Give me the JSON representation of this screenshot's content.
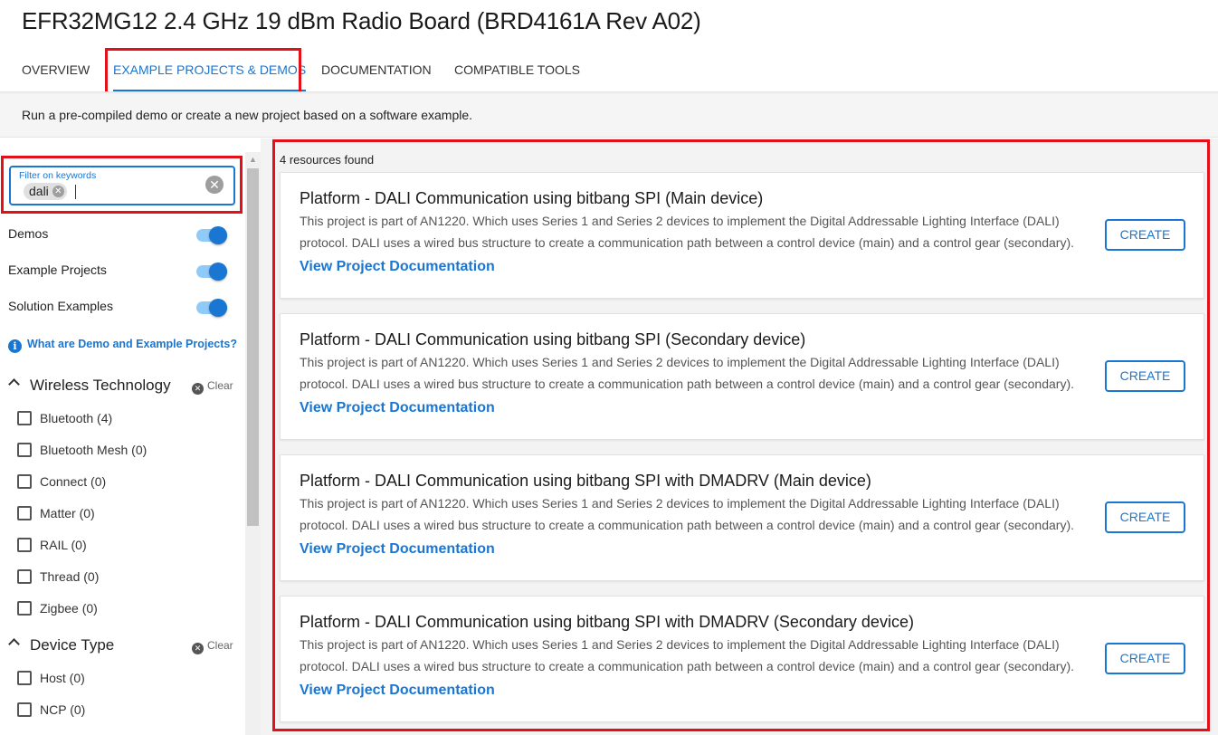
{
  "page": {
    "title": "EFR32MG12 2.4 GHz 19 dBm Radio Board (BRD4161A Rev A02)",
    "subtitle": "Run a pre-compiled demo or create a new project based on a software example."
  },
  "tabs": [
    {
      "label": "OVERVIEW",
      "active": false
    },
    {
      "label": "EXAMPLE PROJECTS & DEMOS",
      "active": true
    },
    {
      "label": "DOCUMENTATION",
      "active": false
    },
    {
      "label": "COMPATIBLE TOOLS",
      "active": false
    }
  ],
  "filter": {
    "label": "Filter on keywords",
    "chips": [
      "dali"
    ],
    "value": ""
  },
  "toggles": [
    {
      "label": "Demos",
      "on": true
    },
    {
      "label": "Example Projects",
      "on": true
    },
    {
      "label": "Solution Examples",
      "on": true
    }
  ],
  "info_link": "What are Demo and Example Projects?",
  "sections": [
    {
      "title": "Wireless Technology",
      "clear_label": "Clear",
      "expanded": true,
      "options": [
        {
          "label": "Bluetooth (4)",
          "checked": false
        },
        {
          "label": "Bluetooth Mesh (0)",
          "checked": false
        },
        {
          "label": "Connect (0)",
          "checked": false
        },
        {
          "label": "Matter (0)",
          "checked": false
        },
        {
          "label": "RAIL (0)",
          "checked": false
        },
        {
          "label": "Thread (0)",
          "checked": false
        },
        {
          "label": "Zigbee (0)",
          "checked": false
        }
      ]
    },
    {
      "title": "Device Type",
      "clear_label": "Clear",
      "expanded": true,
      "options": [
        {
          "label": "Host (0)",
          "checked": false
        },
        {
          "label": "NCP (0)",
          "checked": false
        }
      ]
    }
  ],
  "results": {
    "count_text": "4 resources found",
    "items": [
      {
        "title": "Platform - DALI Communication using bitbang SPI (Main device)",
        "description": "This project is part of AN1220. Which uses Series 1 and Series 2 devices to implement the Digital Addressable Lighting Interface (DALI) protocol. DALI uses a wired bus structure to create a communication path between a control device (main) and a control gear (secondary).",
        "link": "View Project Documentation",
        "button": "CREATE"
      },
      {
        "title": "Platform - DALI Communication using bitbang SPI (Secondary device)",
        "description": "This project is part of AN1220. Which uses Series 1 and Series 2 devices to implement the Digital Addressable Lighting Interface (DALI) protocol. DALI uses a wired bus structure to create a communication path between a control device (main) and a control gear (secondary).",
        "link": "View Project Documentation",
        "button": "CREATE"
      },
      {
        "title": "Platform - DALI Communication using bitbang SPI with DMADRV (Main device)",
        "description": "This project is part of AN1220. Which uses Series 1 and Series 2 devices to implement the Digital Addressable Lighting Interface (DALI) protocol. DALI uses a wired bus structure to create a communication path between a control device (main) and a control gear (secondary).",
        "link": "View Project Documentation",
        "button": "CREATE"
      },
      {
        "title": "Platform - DALI Communication using bitbang SPI with DMADRV (Secondary device)",
        "description": "This project is part of AN1220. Which uses Series 1 and Series 2 devices to implement the Digital Addressable Lighting Interface (DALI) protocol. DALI uses a wired bus structure to create a communication path between a control device (main) and a control gear (secondary).",
        "link": "View Project Documentation",
        "button": "CREATE"
      }
    ]
  },
  "colors": {
    "accent": "#1976d2",
    "highlight": "#e3101a"
  },
  "icons": {
    "chip_remove": "close-circle-icon",
    "clear_input": "close-circle-icon",
    "info": "info-circle-icon",
    "section_toggle": "chevron-up-icon",
    "section_clear": "close-circle-icon"
  }
}
